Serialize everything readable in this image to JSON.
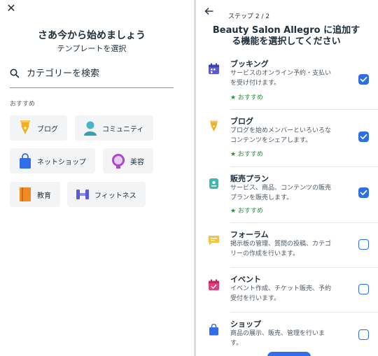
{
  "left": {
    "title": "さあ今から始めましょう",
    "subtitle": "テンプレートを選択",
    "search": {
      "placeholder": "カテゴリーを検索"
    },
    "section_label": "おすすめ",
    "categories": [
      {
        "label": "ブログ",
        "icon": "pen-nib-icon"
      },
      {
        "label": "コミュニティ",
        "icon": "person-icon"
      },
      {
        "label": "ネットショップ",
        "icon": "shopping-bag-icon"
      },
      {
        "label": "美容",
        "icon": "mirror-icon"
      },
      {
        "label": "教育",
        "icon": "book-icon"
      },
      {
        "label": "フィットネス",
        "icon": "dumbbell-icon"
      }
    ]
  },
  "right": {
    "step": "ステップ 2 / 2",
    "title_line1": "Beauty Salon Allegro に追加す",
    "title_line2": "る機能を選択してください",
    "recommended_label": "★ おすすめ",
    "features": [
      {
        "name": "ブッキング",
        "desc1": "サービスのオンライン予約・支払い",
        "desc2": "を受け付けます。",
        "recommended": true,
        "checked": true,
        "icon": "calendar-icon",
        "color": "#5b5bd6"
      },
      {
        "name": "ブログ",
        "desc1": "ブログを始めメンバーといろいろな",
        "desc2": "コンテンツをシェアします。",
        "recommended": true,
        "checked": true,
        "icon": "pen-nib-icon",
        "color": "#f2b01e"
      },
      {
        "name": "販売プラン",
        "desc1": "サービス、商品、コンテンツの販売",
        "desc2": "プランを販売します。",
        "recommended": true,
        "checked": true,
        "icon": "tag-icon",
        "color": "#3fb8b0"
      },
      {
        "name": "フォーラム",
        "desc1": "掲示板の管理、質問の投稿、カテゴ",
        "desc2": "リーの作成を行います。",
        "recommended": false,
        "checked": false,
        "icon": "chat-icon",
        "color": "#f5c242"
      },
      {
        "name": "イベント",
        "desc1": "イベント作成、チケット販売、予約",
        "desc2": "受付を行います。",
        "recommended": false,
        "checked": false,
        "icon": "event-calendar-icon",
        "color": "#e0407a"
      },
      {
        "name": "ショップ",
        "desc1": "商品の展示、販売、管理を行いま",
        "desc2": "す。",
        "recommended": false,
        "checked": false,
        "icon": "shopping-bag-icon",
        "color": "#2f6ee8"
      }
    ]
  },
  "colors": {
    "accent": "#2f6ee8",
    "recommended": "#2b8a3e"
  }
}
